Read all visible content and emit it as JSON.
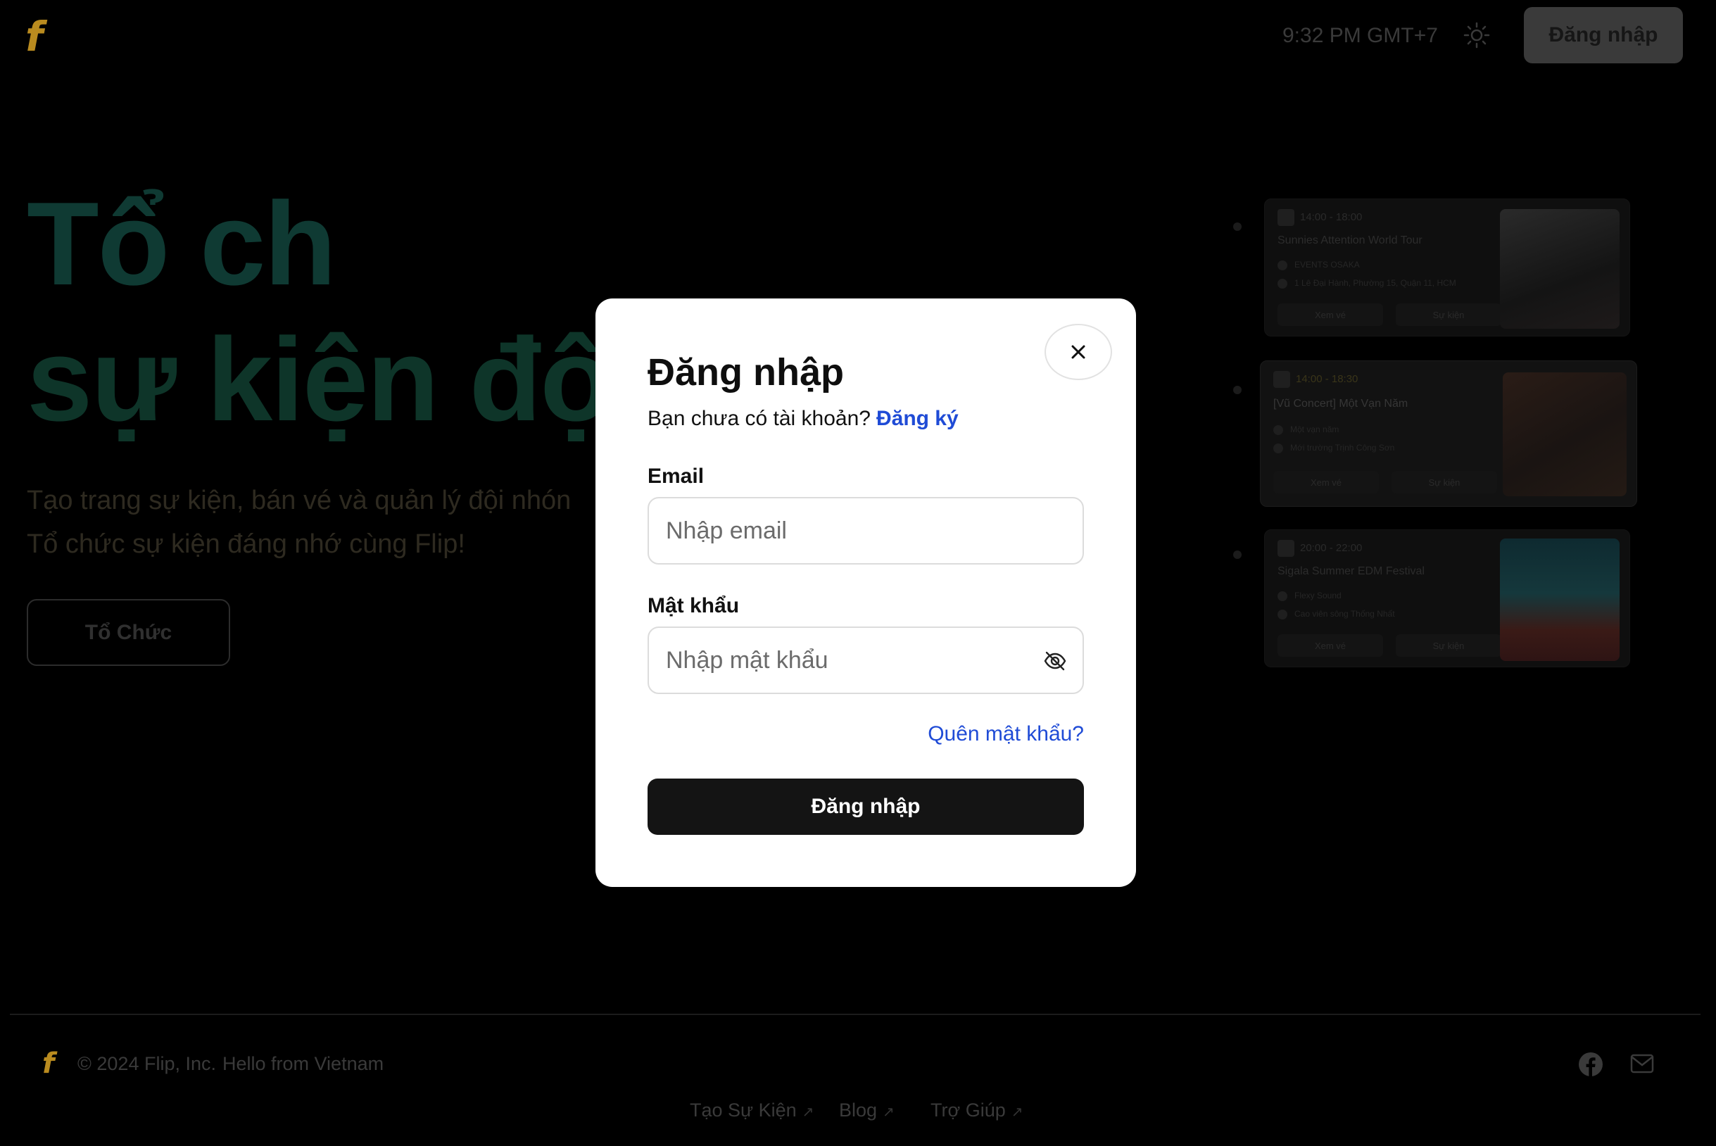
{
  "header": {
    "logo": "f",
    "time": "9:32 PM GMT+7",
    "login_label": "Đăng nhập"
  },
  "hero": {
    "line1": "Tổ ch",
    "line2": "sự kiện độc",
    "sub1": "Tạo trang sự kiện, bán vé và quản lý đội nhón",
    "sub2": "Tổ chức sự kiện đáng nhớ cùng Flip!",
    "cta_label": "Tổ Chức"
  },
  "events": [
    {
      "time": "14:00 - 18:00",
      "title": "Sunnies Attention World Tour",
      "organizer": "EVENTS OSAKA",
      "location": "1 Lê Đại Hành, Phường 15, Quận 11, HCM",
      "buy_label": "Xem vé",
      "detail_label": "Sự kiện"
    },
    {
      "time": "14:00 - 18:30",
      "title": "[Vũ Concert] Một Vạn Năm",
      "organizer": "Một vạn năm",
      "location": "Mới trường Trịnh Công Sơn",
      "buy_label": "Xem vé",
      "detail_label": "Sự kiện"
    },
    {
      "time": "20:00 - 22:00",
      "title": "Sigala Summer EDM Festival",
      "organizer": "Flexy Sound",
      "location": "Cao viên sông Thống Nhất",
      "buy_label": "Xem vé",
      "detail_label": "Sự kiện"
    }
  ],
  "footer": {
    "logo": "f",
    "copyright": "© 2024 Flip, Inc.",
    "hello": "Hello from Vietnam",
    "links": [
      "Tạo Sự Kiện",
      "Blog",
      "Trợ Giúp"
    ],
    "external_glyph": "↗"
  },
  "modal": {
    "title": "Đăng nhập",
    "no_account_text": "Bạn chưa có tài khoản?",
    "signup_link": "Đăng ký",
    "email_label": "Email",
    "email_placeholder": "Nhập email",
    "email_value": "",
    "password_label": "Mật khẩu",
    "password_placeholder": "Nhập mật khẩu",
    "password_value": "",
    "forgot_link": "Quên mật khẩu?",
    "submit_label": "Đăng nhập",
    "close_icon": "close-icon",
    "eye_icon": "eye-off-icon"
  },
  "colors": {
    "brand_gold": "#b98b1f",
    "link_blue": "#1f4bd6",
    "button_dark": "#141414"
  }
}
